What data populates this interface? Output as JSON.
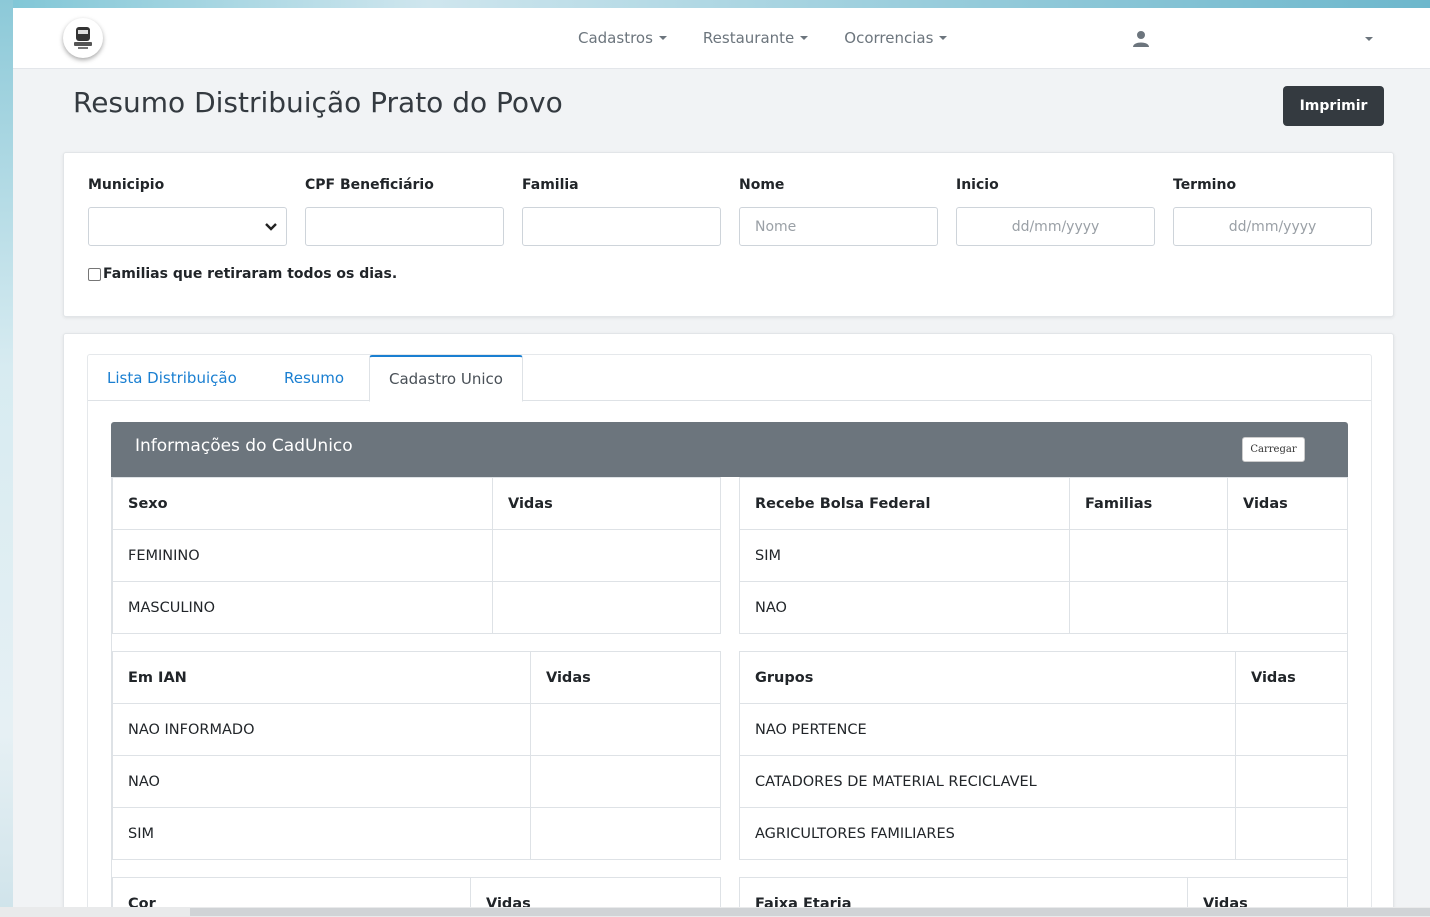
{
  "navbar": {
    "logo": "bus-logo-icon",
    "menu": [
      {
        "label": "Cadastros"
      },
      {
        "label": "Restaurante"
      },
      {
        "label": "Ocorrencias"
      }
    ],
    "user_icon": "user-icon"
  },
  "page": {
    "title": "Resumo Distribuição Prato do Povo",
    "print_label": "Imprimir"
  },
  "filters": {
    "municipio_label": "Municipio",
    "municipio_value": "",
    "cpf_label": "CPF Beneficiário",
    "cpf_value": "",
    "familia_label": "Familia",
    "familia_value": "",
    "nome_label": "Nome",
    "nome_placeholder": "Nome",
    "inicio_label": "Inicio",
    "inicio_placeholder": "dd/mm/yyyy",
    "termino_label": "Termino",
    "termino_placeholder": "dd/mm/yyyy",
    "checkbox_label": "Familias que retiraram todos os dias.",
    "checkbox_checked": false
  },
  "tabs": [
    {
      "label": "Lista Distribuição",
      "active": false
    },
    {
      "label": "Resumo",
      "active": false
    },
    {
      "label": "Cadastro Unico",
      "active": true
    }
  ],
  "cadunico": {
    "title": "Informações do CadUnico",
    "load_label": "Carregar",
    "sexo": {
      "headers": [
        "Sexo",
        "Vidas"
      ],
      "rows": [
        [
          "FEMININO",
          ""
        ],
        [
          "MASCULINO",
          ""
        ]
      ]
    },
    "bolsa": {
      "headers": [
        "Recebe Bolsa Federal",
        "Familias",
        "Vidas"
      ],
      "rows": [
        [
          "SIM",
          "",
          ""
        ],
        [
          "NAO",
          "",
          ""
        ]
      ]
    },
    "ian": {
      "headers": [
        "Em IAN",
        "Vidas"
      ],
      "rows": [
        [
          "NAO INFORMADO",
          ""
        ],
        [
          "NAO",
          ""
        ],
        [
          "SIM",
          ""
        ]
      ]
    },
    "grupos": {
      "headers": [
        "Grupos",
        "Vidas"
      ],
      "rows": [
        [
          "NAO PERTENCE",
          ""
        ],
        [
          "CATADORES DE MATERIAL RECICLAVEL",
          ""
        ],
        [
          "AGRICULTORES FAMILIARES",
          ""
        ]
      ]
    },
    "cor": {
      "headers": [
        "Cor",
        "Vidas"
      ]
    },
    "faixa": {
      "headers": [
        "Faixa Etaria",
        "Vidas"
      ]
    }
  },
  "colors": {
    "accent": "#1a7fd1",
    "print_button": "#343a40",
    "panel_header": "#6c757d"
  }
}
